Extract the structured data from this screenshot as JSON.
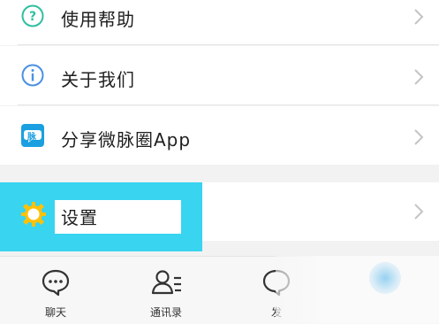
{
  "menu": {
    "help_label": "使用帮助",
    "about_label": "关于我们",
    "share_label": "分享微脉圈App",
    "share_badge": "脉",
    "settings_label": "设置"
  },
  "tabs": [
    {
      "label": "聊天",
      "icon": "chat-bubble-icon"
    },
    {
      "label": "通讯录",
      "icon": "contacts-icon"
    },
    {
      "label": "发",
      "icon": "discover-icon"
    }
  ],
  "colors": {
    "help_icon": "#2fbfa0",
    "about_icon": "#4a90e2",
    "share_badge": "#1aa0e0",
    "settings_icon": "#ffc107",
    "settings_highlight": "#38d4f0"
  }
}
